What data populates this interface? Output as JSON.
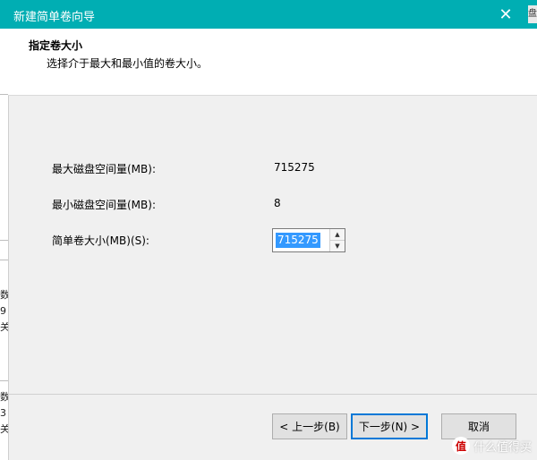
{
  "window": {
    "title": "新建简单卷向导",
    "close_glyph": "✕",
    "peek_text": "盘"
  },
  "header": {
    "title": "指定卷大小",
    "subtitle": "选择介于最大和最小值的卷大小。"
  },
  "content": {
    "max_label": "最大磁盘空间量(MB):",
    "max_value": "715275",
    "min_label": "最小磁盘空间量(MB):",
    "min_value": "8",
    "size_label": "简单卷大小(MB)(S):",
    "size_value": "715275",
    "spin_up_glyph": "▲",
    "spin_down_glyph": "▼"
  },
  "buttons": {
    "back": "< 上一步(B)",
    "next": "下一步(N) >",
    "cancel": "取消"
  },
  "background_window": {
    "fragments": [
      "数",
      "9",
      "关",
      "数",
      "3",
      "关"
    ]
  },
  "watermark": {
    "logo": "值",
    "text": "什么值得买"
  },
  "colors": {
    "titlebar": "#00aeb3",
    "selection": "#3399ff",
    "focus_border": "#0078d7"
  }
}
